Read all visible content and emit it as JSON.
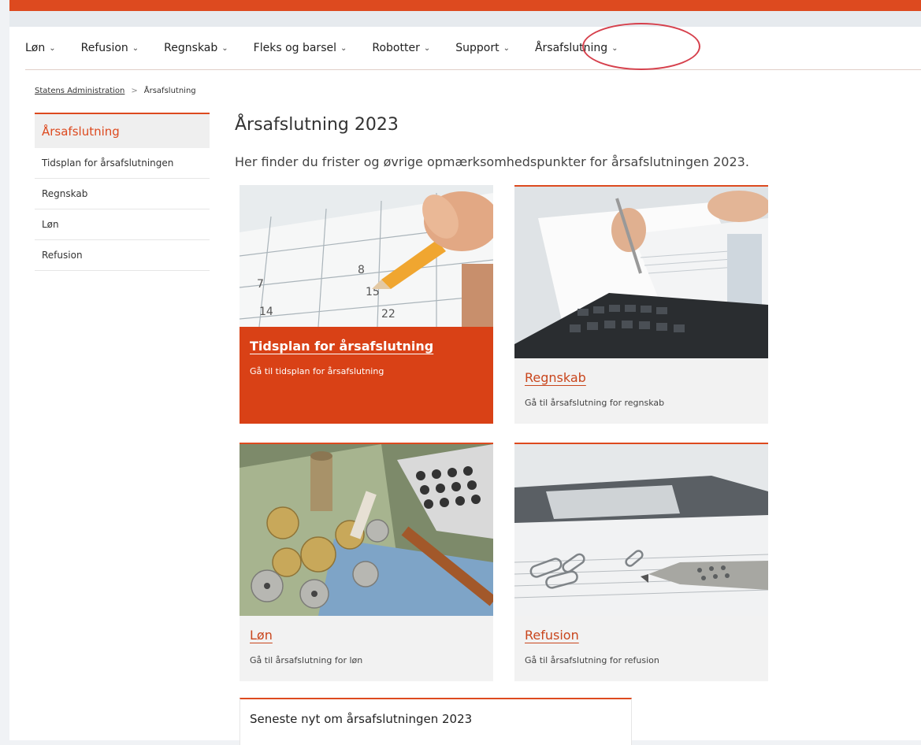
{
  "nav": {
    "items": [
      {
        "label": "Løn"
      },
      {
        "label": "Refusion"
      },
      {
        "label": "Regnskab"
      },
      {
        "label": "Fleks og barsel"
      },
      {
        "label": "Robotter"
      },
      {
        "label": "Support"
      },
      {
        "label": "Årsafslutning"
      }
    ],
    "chevron": "⌄"
  },
  "breadcrumb": {
    "home": "Statens Administration",
    "separator": ">",
    "current": "Årsafslutning"
  },
  "sidebar": {
    "active": "Årsafslutning",
    "items": [
      {
        "label": "Tidsplan for årsafslutningen"
      },
      {
        "label": "Regnskab"
      },
      {
        "label": "Løn"
      },
      {
        "label": "Refusion"
      }
    ]
  },
  "main": {
    "title": "Årsafslutning 2023",
    "lead": "Her finder du frister og øvrige opmærksomhedspunkter for årsafslutningen 2023.",
    "cards": [
      {
        "title": "Tidsplan for årsafslutning",
        "subtitle": "Gå til tidsplan for årsafslutning",
        "image": "calendar-pencil-image"
      },
      {
        "title": "Regnskab",
        "subtitle": "Gå til årsafslutning for regnskab",
        "image": "keyboard-documents-image"
      },
      {
        "title": "Løn",
        "subtitle": "Gå til årsafslutning for løn",
        "image": "coins-calculator-image"
      },
      {
        "title": "Refusion",
        "subtitle": "Gå til årsafslutning for refusion",
        "image": "paperclips-pen-image"
      }
    ],
    "news_title": "Seneste nyt om årsafslutningen 2023"
  },
  "colors": {
    "brand": "#dd4a1f",
    "highlight_ring": "#d6404c",
    "text": "#333333"
  }
}
